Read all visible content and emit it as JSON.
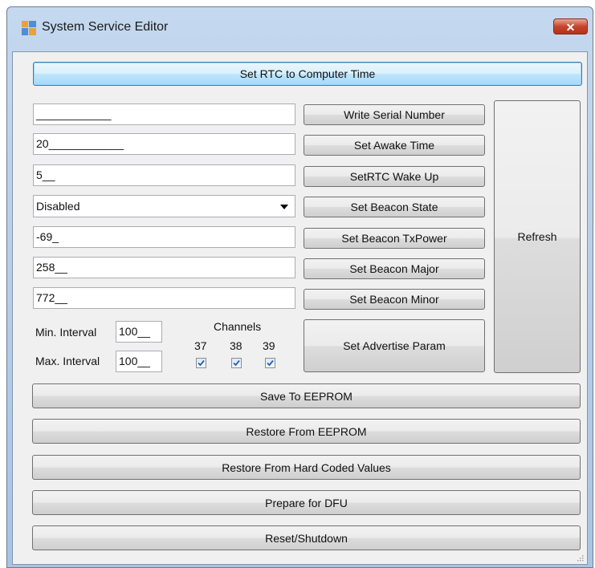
{
  "window": {
    "title": "System Service Editor",
    "close_glyph": "✕"
  },
  "buttons": {
    "set_rtc": "Set RTC to Computer Time",
    "write_serial": "Write Serial  Number",
    "set_awake": "Set Awake Time",
    "set_rtc_wake": "SetRTC Wake Up",
    "set_beacon_state": "Set Beacon State",
    "set_beacon_txpower": "Set Beacon TxPower",
    "set_beacon_major": "Set Beacon Major",
    "set_beacon_minor": "Set Beacon Minor",
    "set_advertise": "Set Advertise Param",
    "refresh": "Refresh",
    "save_eeprom": "Save To EEPROM",
    "restore_eeprom": "Restore From EEPROM",
    "restore_hard": "Restore From Hard Coded Values",
    "prepare_dfu": "Prepare for DFU",
    "reset_shutdown": "Reset/Shutdown"
  },
  "fields": {
    "serial": "____________",
    "awake": "20____________",
    "rtc_wake": "5__",
    "beacon_state": "Disabled",
    "txpower": "-69_",
    "major": "258__",
    "minor": "772__",
    "min_interval": "100__",
    "max_interval": "100__"
  },
  "labels": {
    "min_interval": "Min. Interval",
    "max_interval": "Max. Interval",
    "channels": "Channels",
    "ch37": "37",
    "ch38": "38",
    "ch39": "39"
  },
  "channels_checked": {
    "ch37": true,
    "ch38": true,
    "ch39": true
  },
  "colors": {
    "titlebar": "#bcd2ea",
    "close": "#c7452c",
    "client": "#f0f0f0"
  }
}
